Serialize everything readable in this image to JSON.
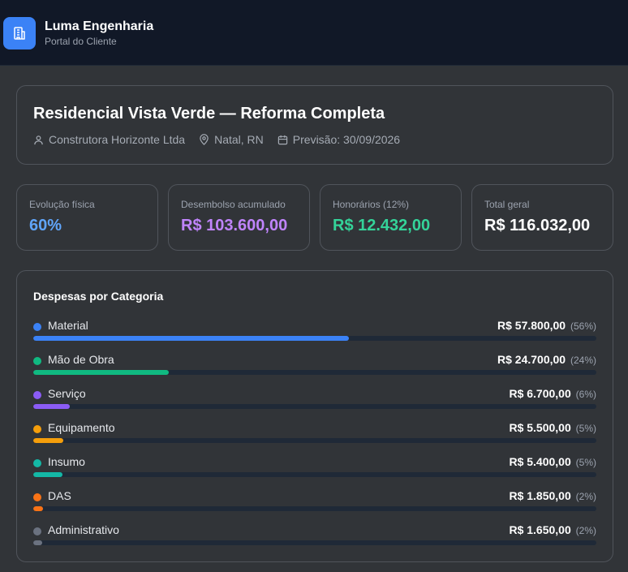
{
  "header": {
    "brand": "Luma Engenharia",
    "subtitle": "Portal do Cliente",
    "logo_icon": "building-icon"
  },
  "project": {
    "title": "Residencial Vista Verde — Reforma Completa",
    "company": "Construtora Horizonte Ltda",
    "location": "Natal, RN",
    "forecast": "Previsão: 30/09/2026"
  },
  "kpis": [
    {
      "label": "Evolução física",
      "value": "60%",
      "color": "#60a5fa"
    },
    {
      "label": "Desembolso acumulado",
      "value": "R$ 103.600,00",
      "color": "#c084fc"
    },
    {
      "label": "Honorários (12%)",
      "value": "R$ 12.432,00",
      "color": "#34d399"
    },
    {
      "label": "Total geral",
      "value": "R$ 116.032,00",
      "color": "#ffffff"
    }
  ],
  "expenses": {
    "title": "Despesas por Categoria",
    "items": [
      {
        "name": "Material",
        "value": "R$ 57.800,00",
        "pct": "(56%)",
        "share": 0.56,
        "color": "#3b82f6"
      },
      {
        "name": "Mão de Obra",
        "value": "R$ 24.700,00",
        "pct": "(24%)",
        "share": 0.24,
        "color": "#10b981"
      },
      {
        "name": "Serviço",
        "value": "R$ 6.700,00",
        "pct": "(6%)",
        "share": 0.065,
        "color": "#8b5cf6"
      },
      {
        "name": "Equipamento",
        "value": "R$ 5.500,00",
        "pct": "(5%)",
        "share": 0.053,
        "color": "#f59e0b"
      },
      {
        "name": "Insumo",
        "value": "R$ 5.400,00",
        "pct": "(5%)",
        "share": 0.052,
        "color": "#14b8a6"
      },
      {
        "name": "DAS",
        "value": "R$ 1.850,00",
        "pct": "(2%)",
        "share": 0.018,
        "color": "#f97316"
      },
      {
        "name": "Administrativo",
        "value": "R$ 1.650,00",
        "pct": "(2%)",
        "share": 0.016,
        "color": "#6b7280"
      }
    ]
  }
}
